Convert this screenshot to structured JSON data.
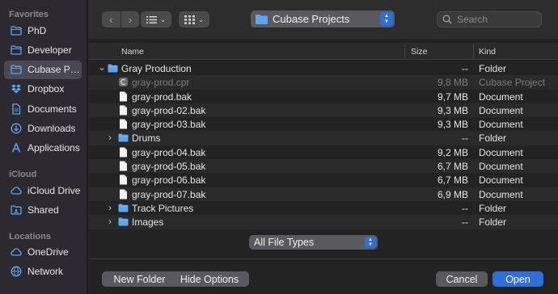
{
  "sidebar": {
    "favorites_title": "Favorites",
    "icloud_title": "iCloud",
    "locations_title": "Locations",
    "favorites": [
      {
        "label": "PhD",
        "icon": "folder-icon"
      },
      {
        "label": "Developer",
        "icon": "folder-icon"
      },
      {
        "label": "Cubase Projects",
        "icon": "folder-icon",
        "selected": true
      },
      {
        "label": "Dropbox",
        "icon": "dropbox-icon"
      },
      {
        "label": "Documents",
        "icon": "document-icon"
      },
      {
        "label": "Downloads",
        "icon": "download-icon"
      },
      {
        "label": "Applications",
        "icon": "applications-icon"
      }
    ],
    "icloud": [
      {
        "label": "iCloud Drive",
        "icon": "cloud-icon"
      },
      {
        "label": "Shared",
        "icon": "shared-folder-icon"
      }
    ],
    "locations": [
      {
        "label": "OneDrive",
        "icon": "cloud-icon"
      },
      {
        "label": "Network",
        "icon": "globe-icon"
      }
    ]
  },
  "toolbar": {
    "back": "‹",
    "forward": "›",
    "location": "Cubase Projects",
    "search_placeholder": "Search"
  },
  "columns": {
    "name": "Name",
    "size": "Size",
    "kind": "Kind"
  },
  "rows": [
    {
      "name": "Gray Production",
      "size": "--",
      "kind": "Folder",
      "type": "folder",
      "level": 0,
      "disclosure": "open"
    },
    {
      "name": "gray-prod.cpr",
      "size": "9,8 MB",
      "kind": "Cubase Project",
      "type": "cpr",
      "level": 1,
      "dim": true
    },
    {
      "name": "gray-prod.bak",
      "size": "9,7 MB",
      "kind": "Document",
      "type": "doc",
      "level": 1
    },
    {
      "name": "gray-prod-02.bak",
      "size": "9,3 MB",
      "kind": "Document",
      "type": "doc",
      "level": 1
    },
    {
      "name": "gray-prod-03.bak",
      "size": "9,3 MB",
      "kind": "Document",
      "type": "doc",
      "level": 1
    },
    {
      "name": "Drums",
      "size": "--",
      "kind": "Folder",
      "type": "folder",
      "level": 1,
      "disclosure": "closed"
    },
    {
      "name": "gray-prod-04.bak",
      "size": "9,2 MB",
      "kind": "Document",
      "type": "doc",
      "level": 1
    },
    {
      "name": "gray-prod-05.bak",
      "size": "6,7 MB",
      "kind": "Document",
      "type": "doc",
      "level": 1
    },
    {
      "name": "gray-prod-06.bak",
      "size": "6,7 MB",
      "kind": "Document",
      "type": "doc",
      "level": 1
    },
    {
      "name": "gray-prod-07.bak",
      "size": "6,9 MB",
      "kind": "Document",
      "type": "doc",
      "level": 1
    },
    {
      "name": "Track Pictures",
      "size": "--",
      "kind": "Folder",
      "type": "folder",
      "level": 1,
      "disclosure": "closed"
    },
    {
      "name": "Images",
      "size": "--",
      "kind": "Folder",
      "type": "folder",
      "level": 1,
      "disclosure": "closed"
    }
  ],
  "footer": {
    "file_types": "All File Types",
    "new_folder": "New Folder",
    "hide_options": "Hide Options",
    "cancel": "Cancel",
    "open": "Open"
  },
  "colors": {
    "accent": "#2f6fdb",
    "folder": "#5aa7f0"
  }
}
